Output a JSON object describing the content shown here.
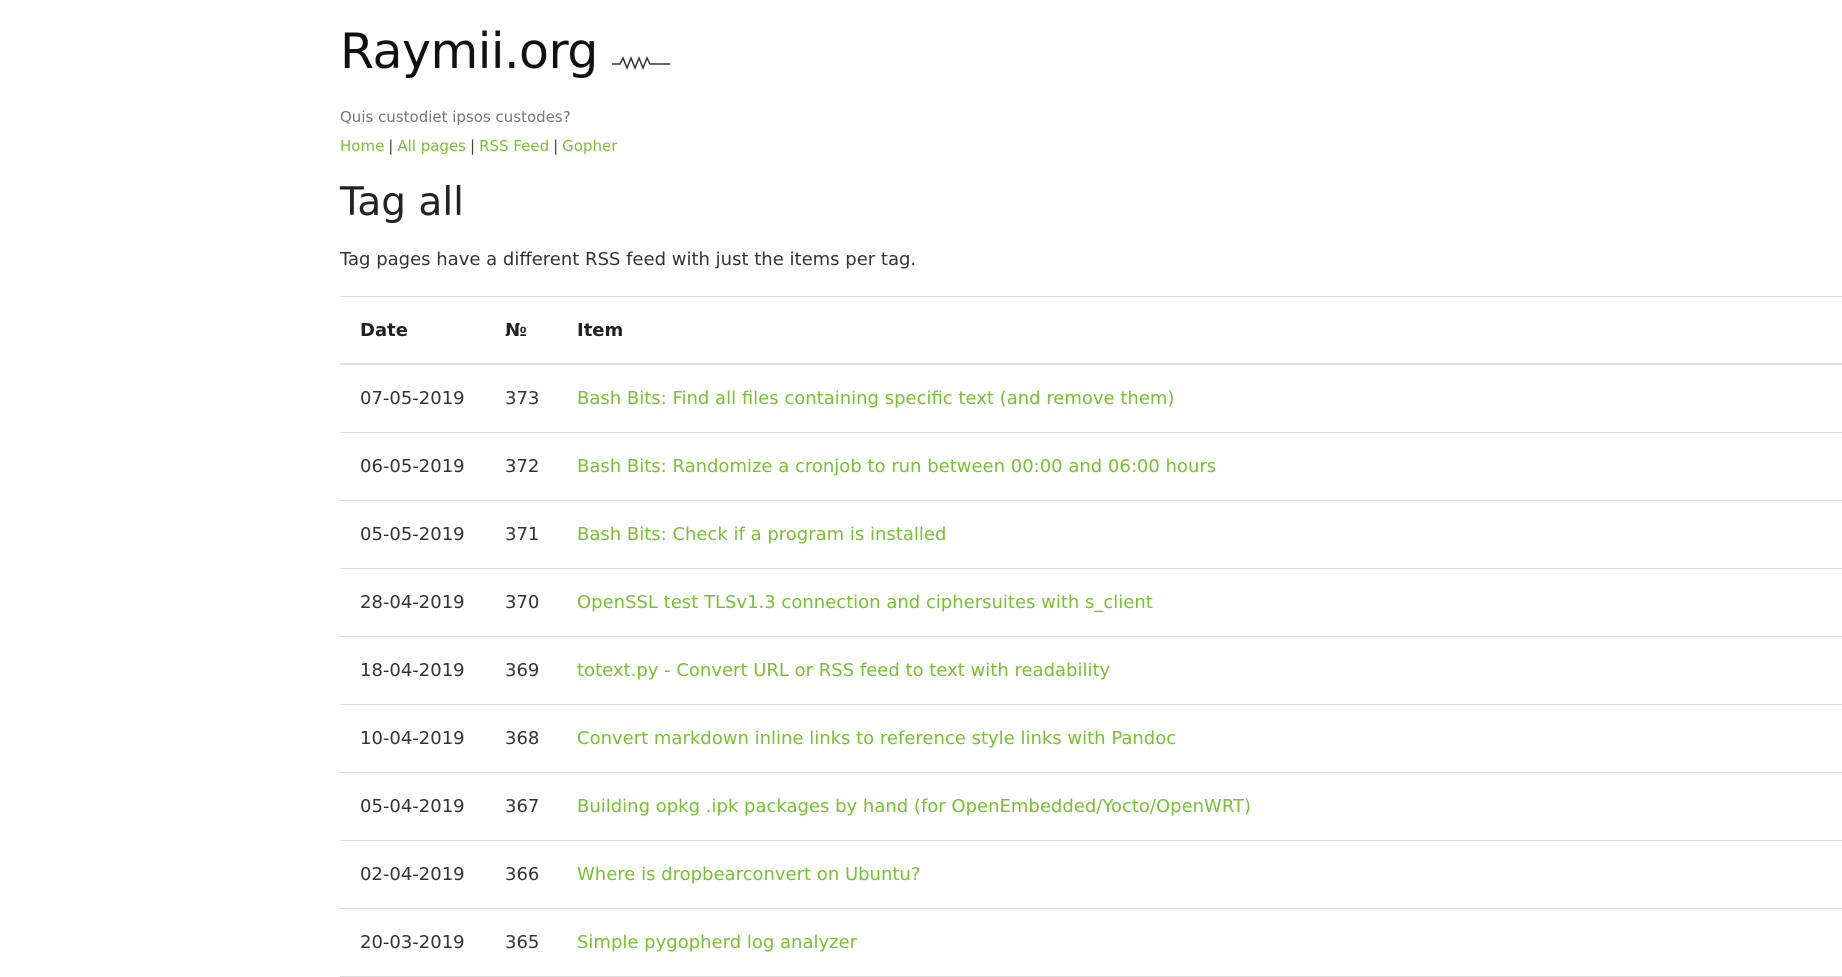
{
  "site": {
    "title": "Raymii.org",
    "tagline": "Quis custodiet ipsos custodes?",
    "nav": [
      {
        "label": "Home"
      },
      {
        "label": "All pages"
      },
      {
        "label": "RSS Feed"
      },
      {
        "label": "Gopher"
      }
    ],
    "nav_separator": "|",
    "accent_color": "#77c22f",
    "logo_icon": "squiggle-wave-icon"
  },
  "page": {
    "title": "Tag all",
    "intro": "Tag pages have a different RSS feed with just the items per tag."
  },
  "table": {
    "headers": {
      "date": "Date",
      "number": "№",
      "item": "Item"
    },
    "rows": [
      {
        "date": "07-05-2019",
        "number": "373",
        "item": "Bash Bits: Find all files containing specific text (and remove them)"
      },
      {
        "date": "06-05-2019",
        "number": "372",
        "item": "Bash Bits: Randomize a cronjob to run between 00:00 and 06:00 hours"
      },
      {
        "date": "05-05-2019",
        "number": "371",
        "item": "Bash Bits: Check if a program is installed"
      },
      {
        "date": "28-04-2019",
        "number": "370",
        "item": "OpenSSL test TLSv1.3 connection and ciphersuites with s_client"
      },
      {
        "date": "18-04-2019",
        "number": "369",
        "item": "totext.py - Convert URL or RSS feed to text with readability"
      },
      {
        "date": "10-04-2019",
        "number": "368",
        "item": "Convert markdown inline links to reference style links with Pandoc"
      },
      {
        "date": "05-04-2019",
        "number": "367",
        "item": "Building opkg .ipk packages by hand (for OpenEmbedded/Yocto/OpenWRT)"
      },
      {
        "date": "02-04-2019",
        "number": "366",
        "item": "Where is dropbearconvert on Ubuntu?"
      },
      {
        "date": "20-03-2019",
        "number": "365",
        "item": "Simple pygopherd log analyzer"
      }
    ]
  }
}
